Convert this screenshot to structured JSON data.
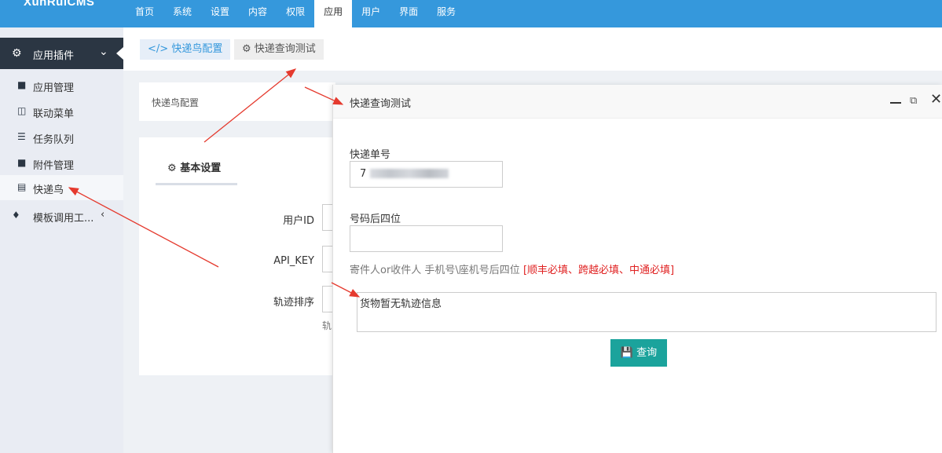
{
  "app": {
    "logo": "XunRuiCMS"
  },
  "topnav": [
    "首页",
    "系统",
    "设置",
    "内容",
    "权限",
    "应用",
    "用户",
    "界面",
    "服务"
  ],
  "topnav_active": "应用",
  "sidebar": {
    "header": "应用插件",
    "items": [
      {
        "label": "应用管理",
        "icon": "folder-icon"
      },
      {
        "label": "联动菜单",
        "icon": "columns-icon"
      },
      {
        "label": "任务队列",
        "icon": "list-icon"
      },
      {
        "label": "附件管理",
        "icon": "folder-icon"
      },
      {
        "label": "快递鸟",
        "icon": "table-icon"
      }
    ],
    "active_item": "快递鸟",
    "group2": "模板调用工..."
  },
  "tabs": [
    {
      "label": "快递鸟配置",
      "icon": "code-icon"
    },
    {
      "label": "快递查询测试",
      "icon": "gear-icon"
    }
  ],
  "config_panel": {
    "title": "快递鸟配置",
    "section": "基本设置",
    "fields": [
      {
        "label": "用户ID"
      },
      {
        "label": "API_KEY"
      },
      {
        "label": "轨迹排序",
        "hint": "轨"
      }
    ]
  },
  "modal": {
    "title": "快递查询测试",
    "tracking_label": "快递单号",
    "tracking_value": "7",
    "phone_label": "号码后四位",
    "phone_value": "",
    "hint_text": "寄件人or收件人 手机号\\座机号后四位 ",
    "hint_required": "[顺丰必填、跨越必填、中通必填]",
    "result": "货物暂无轨迹信息",
    "query_button": "查询"
  },
  "colors": {
    "topbar": "#3598dc",
    "sidebar_header": "#2b3643",
    "button": "#1ba39c",
    "required_text": "#e02222",
    "annotation_arrow": "#e53a2e"
  }
}
